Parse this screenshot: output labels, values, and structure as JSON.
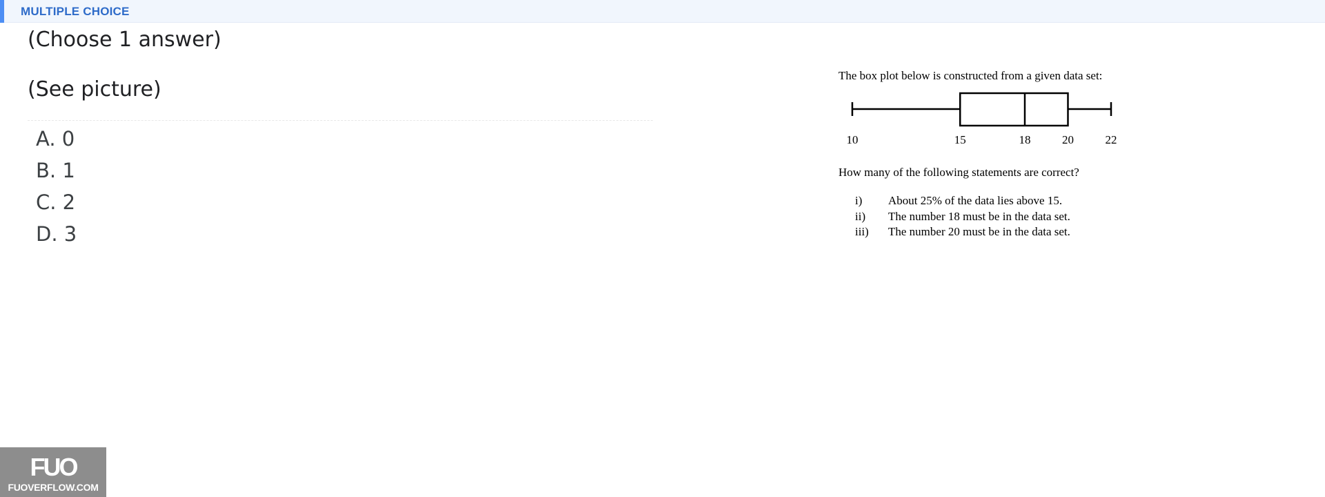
{
  "header": {
    "title": "MULTIPLE CHOICE",
    "accent_color": "#4d8ef4",
    "title_color": "#2e6bc9"
  },
  "question": {
    "instruction": "(Choose 1 answer)",
    "prompt": "(See picture)"
  },
  "options": [
    {
      "label": "A. 0"
    },
    {
      "label": "B. 1"
    },
    {
      "label": "C. 2"
    },
    {
      "label": "D. 3"
    }
  ],
  "picture": {
    "intro": "The box plot below is constructed from a given data set:",
    "question": "How many of the following statements are correct?",
    "statements": [
      {
        "num": "i)",
        "text": "About 25% of the data lies above 15."
      },
      {
        "num": "ii)",
        "text": "The number 18 must be in the data set."
      },
      {
        "num": "iii)",
        "text": "The number 20 must be in the data set."
      }
    ]
  },
  "chart_data": {
    "type": "box",
    "min": 10,
    "q1": 15,
    "median": 18,
    "q3": 20,
    "max": 22,
    "tick_labels": [
      "10",
      "15",
      "18",
      "20",
      "22"
    ],
    "ticks": [
      10,
      15,
      18,
      20,
      22
    ]
  },
  "watermark": {
    "mark": "FUO",
    "text": "FUOVERFLOW.COM"
  }
}
